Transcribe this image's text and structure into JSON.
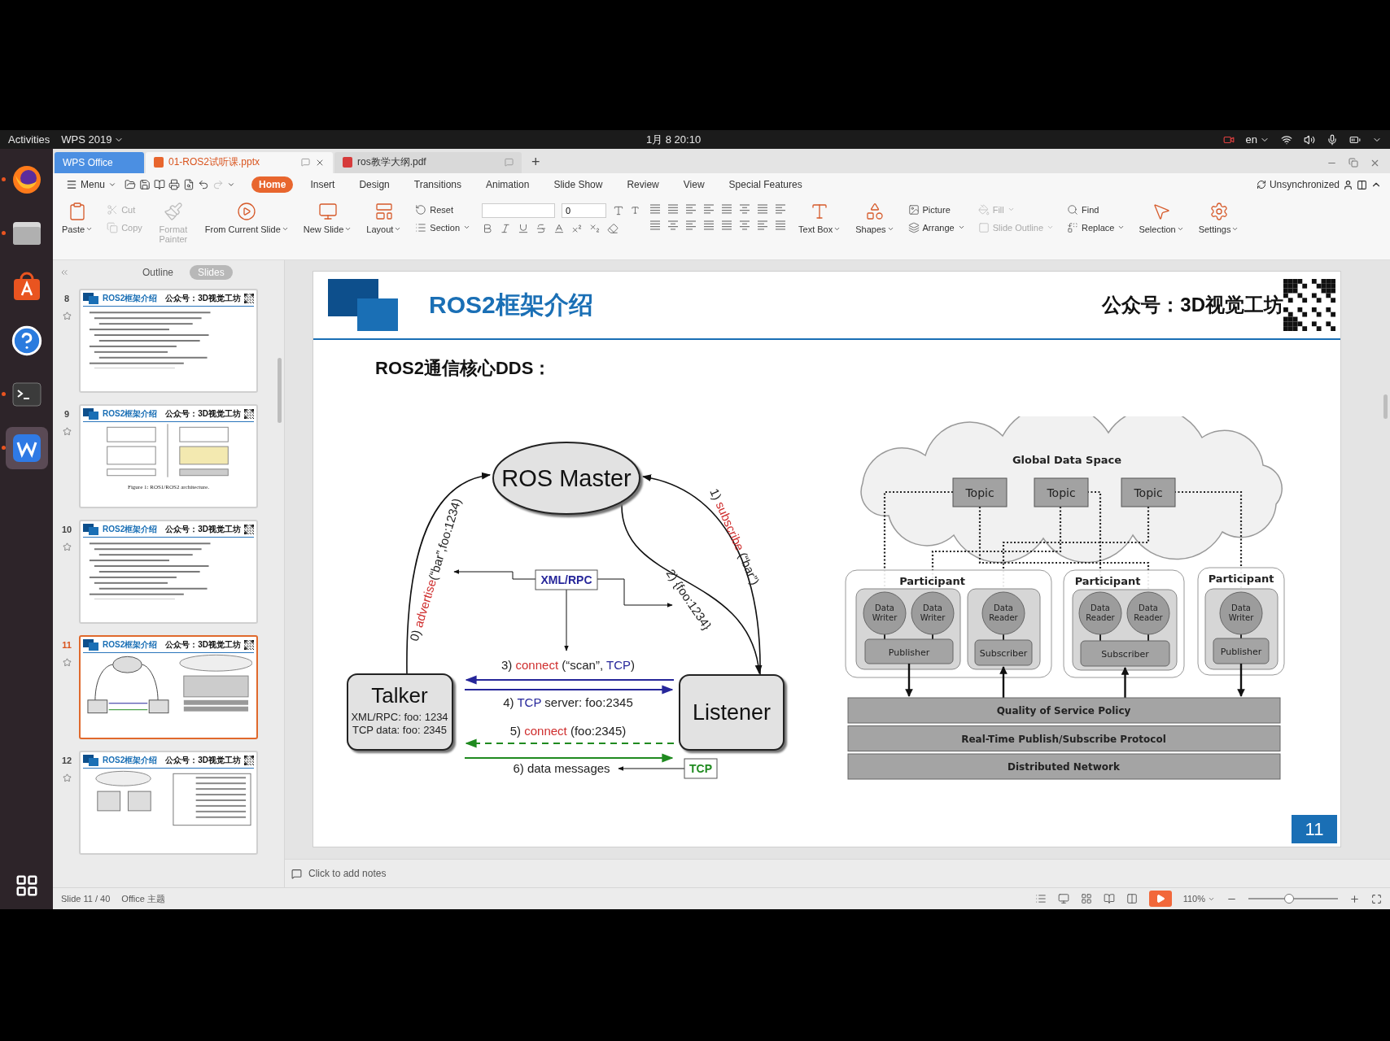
{
  "top_bar": {
    "activities": "Activities",
    "app_menu": "WPS 2019",
    "clock": "1月 8 20:10",
    "language": "en"
  },
  "dock": [
    {
      "kind": "browser",
      "running": true,
      "selected": false
    },
    {
      "kind": "files",
      "running": true,
      "selected": false
    },
    {
      "kind": "store",
      "running": false,
      "selected": false
    },
    {
      "kind": "help",
      "running": false,
      "selected": false
    },
    {
      "kind": "terminal",
      "running": true,
      "selected": false
    },
    {
      "kind": "wps",
      "running": true,
      "selected": true
    }
  ],
  "tabs": [
    {
      "kind": "home",
      "label": "WPS Office",
      "selected": false
    },
    {
      "kind": "presentation",
      "label": "01-ROS2试听课.pptx",
      "selected": true
    },
    {
      "kind": "pdf",
      "label": "ros教学大纲.pdf",
      "selected": false
    }
  ],
  "new_tab": "+",
  "menu": {
    "label": "Menu",
    "tabs": [
      {
        "label": "Home",
        "selected": true
      },
      {
        "label": "Insert",
        "selected": false
      },
      {
        "label": "Design",
        "selected": false
      },
      {
        "label": "Transitions",
        "selected": false
      },
      {
        "label": "Animation",
        "selected": false
      },
      {
        "label": "Slide Show",
        "selected": false
      },
      {
        "label": "Review",
        "selected": false
      },
      {
        "label": "View",
        "selected": false
      },
      {
        "label": "Special Features",
        "selected": false
      }
    ],
    "sync": "Unsynchronized"
  },
  "ribbon": [
    {
      "kind": "large",
      "label": "Paste",
      "disabled": false,
      "menu": true
    },
    {
      "kind": "stack",
      "items": [
        {
          "label": "Cut",
          "disabled": true,
          "menu": false
        },
        {
          "label": "Copy",
          "disabled": true,
          "menu": false
        }
      ]
    },
    {
      "kind": "large",
      "label": "Format Painter",
      "disabled": true,
      "menu": false
    },
    {
      "kind": "large",
      "label": "From Current Slide",
      "disabled": false,
      "menu": true
    },
    {
      "kind": "large",
      "label": "New Slide",
      "disabled": false,
      "menu": true
    },
    {
      "kind": "large",
      "label": "Layout",
      "disabled": false,
      "menu": true
    },
    {
      "kind": "stack",
      "items": [
        {
          "label": "Reset",
          "disabled": false,
          "menu": false
        },
        {
          "label": "Section",
          "disabled": false,
          "menu": true
        }
      ]
    },
    {
      "kind": "font",
      "size": "0"
    },
    {
      "kind": "paragraph"
    },
    {
      "kind": "large",
      "label": "Text Box",
      "disabled": false,
      "menu": true
    },
    {
      "kind": "large",
      "label": "Shapes",
      "disabled": false,
      "menu": true
    },
    {
      "kind": "stack",
      "items": [
        {
          "label": "Picture",
          "disabled": false,
          "menu": false
        },
        {
          "label": "Arrange",
          "disabled": false,
          "menu": true
        }
      ]
    },
    {
      "kind": "stack",
      "items": [
        {
          "label": "Fill",
          "disabled": true,
          "menu": true
        },
        {
          "label": "Slide Outline",
          "disabled": true,
          "menu": true
        }
      ]
    },
    {
      "kind": "stack",
      "items": [
        {
          "label": "Find",
          "disabled": false,
          "menu": false
        },
        {
          "label": "Replace",
          "disabled": false,
          "menu": true
        }
      ]
    },
    {
      "kind": "large",
      "label": "Selection",
      "disabled": false,
      "menu": true
    },
    {
      "kind": "large",
      "label": "Settings",
      "disabled": false,
      "menu": true
    }
  ],
  "sidebar": {
    "view_tabs": [
      {
        "label": "Outline",
        "selected": false
      },
      {
        "label": "Slides",
        "selected": true
      }
    ],
    "thumbnails": [
      {
        "number": "8",
        "title": "ROS2框架介绍",
        "brand": "公众号：3D视觉工坊",
        "kind": "text",
        "selected": false
      },
      {
        "number": "9",
        "title": "ROS2框架介绍",
        "brand": "公众号：3D视觉工坊",
        "kind": "figure",
        "caption": "Figure 1: ROS1/ROS2 architecture.",
        "selected": false
      },
      {
        "number": "10",
        "title": "ROS2框架介绍",
        "brand": "公众号：3D视觉工坊",
        "kind": "text",
        "selected": false
      },
      {
        "number": "11",
        "title": "ROS2框架介绍",
        "brand": "公众号：3D视觉工坊",
        "kind": "diagram",
        "selected": true
      },
      {
        "number": "12",
        "title": "ROS2框架介绍",
        "brand": "公众号：3D视觉工坊",
        "kind": "table",
        "selected": false
      }
    ]
  },
  "slide": {
    "title": "ROS2框架介绍",
    "brand": "公众号：3D视觉工坊",
    "subtitle": "ROS2通信核心DDS：",
    "page": "11",
    "ros_diagram": {
      "master": "ROS Master",
      "talker": {
        "name": "Talker",
        "details": [
          "XML/RPC: foo: 1234",
          "TCP data: foo: 2345"
        ]
      },
      "listener": "Listener",
      "xmlrpc": "XML/RPC",
      "tcp": "TCP",
      "messages": [
        {
          "parts": [
            {
              "text": "0) ",
              "color": "#222222"
            },
            {
              "text": "advertise",
              "color": "#cf2e2e"
            },
            {
              "text": "(“bar”,foo:1234)",
              "color": "#222222"
            }
          ]
        },
        {
          "parts": [
            {
              "text": "1) ",
              "color": "#222222"
            },
            {
              "text": "subscribe",
              "color": "#cf2e2e"
            },
            {
              "text": " (“bar”)",
              "color": "#222222"
            }
          ]
        },
        {
          "parts": [
            {
              "text": "2) {foo:1234}",
              "color": "#222222"
            }
          ]
        },
        {
          "parts": [
            {
              "text": "3) ",
              "color": "#222222"
            },
            {
              "text": "connect",
              "color": "#cf2e2e"
            },
            {
              "text": " (“scan”, ",
              "color": "#222222"
            },
            {
              "text": "TCP",
              "color": "#26269a"
            },
            {
              "text": ")",
              "color": "#222222"
            }
          ]
        },
        {
          "parts": [
            {
              "text": "4) ",
              "color": "#222222"
            },
            {
              "text": "TCP",
              "color": "#26269a"
            },
            {
              "text": " server: foo:2345",
              "color": "#222222"
            }
          ]
        },
        {
          "parts": [
            {
              "text": "5) ",
              "color": "#222222"
            },
            {
              "text": "connect",
              "color": "#cf2e2e"
            },
            {
              "text": " (foo:2345)",
              "color": "#222222"
            }
          ]
        },
        {
          "parts": [
            {
              "text": "6) data messages",
              "color": "#222222"
            }
          ]
        }
      ]
    },
    "dds_diagram": {
      "space": "Global Data Space",
      "topics": [
        "Topic",
        "Topic",
        "Topic"
      ],
      "participants": [
        {
          "label": "Participant",
          "groups": [
            {
              "kind": "publisher",
              "entity": "Publisher",
              "endpoints": [
                [
                  "Data",
                  "Writer"
                ],
                [
                  "Data",
                  "Writer"
                ]
              ]
            },
            {
              "kind": "subscriber",
              "entity": "Subscriber",
              "endpoints": [
                [
                  "Data",
                  "Reader"
                ]
              ]
            }
          ]
        },
        {
          "label": "Participant",
          "groups": [
            {
              "kind": "subscriber",
              "entity": "Subscriber",
              "endpoints": [
                [
                  "Data",
                  "Reader"
                ],
                [
                  "Data",
                  "Reader"
                ]
              ]
            }
          ]
        },
        {
          "label": "Participant",
          "groups": [
            {
              "kind": "publisher",
              "entity": "Publisher",
              "endpoints": [
                [
                  "Data",
                  "Writer"
                ]
              ]
            }
          ]
        }
      ],
      "layers": [
        "Quality of Service Policy",
        "Real-Time Publish/Subscribe Protocol",
        "Distributed Network"
      ]
    }
  },
  "notes_placeholder": "Click to add notes",
  "status_bar": {
    "slide": "Slide 11 / 40",
    "theme": "Office 主题",
    "zoom": "110%",
    "zoom_slider": {
      "level": 0.45
    }
  }
}
